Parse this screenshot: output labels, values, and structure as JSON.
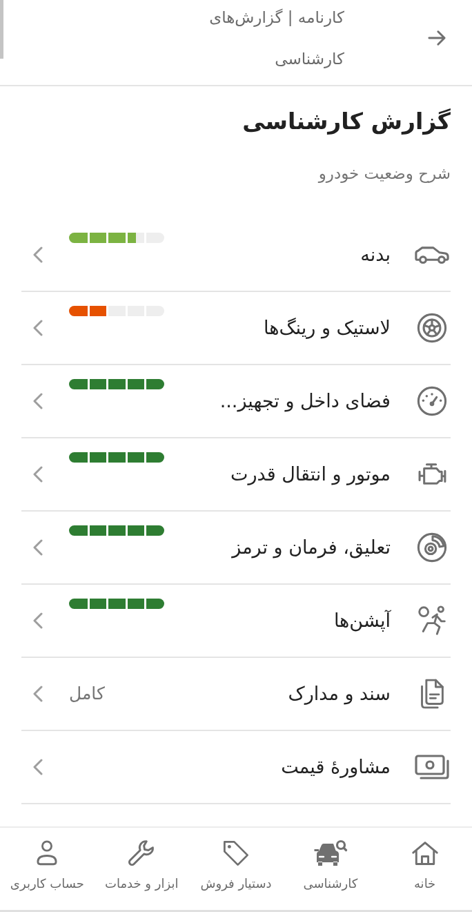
{
  "header": {
    "title": "کارنامه | گزارش‌های کارشناسی"
  },
  "page": {
    "title": "گزارش کارشناسی",
    "subtitle": "شرح وضعیت خودرو"
  },
  "rows": [
    {
      "kind": "meter",
      "label": "بدنه",
      "level": 0.7,
      "color": "#7cb342"
    },
    {
      "kind": "meter",
      "label": "لاستیک و رینگ‌ها",
      "level": 0.4,
      "color": "#e65100"
    },
    {
      "kind": "meter",
      "label": "فضای داخل و تجهیز...",
      "level": 1,
      "color": "#2e7d32"
    },
    {
      "kind": "meter",
      "label": "موتور و انتقال قدرت",
      "level": 1,
      "color": "#2e7d32"
    },
    {
      "kind": "meter",
      "label": "تعلیق، فرمان و ترمز",
      "level": 1,
      "color": "#2e7d32"
    },
    {
      "kind": "meter",
      "label": "آپشن‌ها",
      "level": 1,
      "color": "#2e7d32"
    },
    {
      "kind": "value",
      "label": "سند و مدارک",
      "value": "کامل"
    },
    {
      "kind": "link",
      "label": "مشاورهٔ قیمت"
    }
  ],
  "nav": [
    {
      "label": "خانه"
    },
    {
      "label": "کارشناسی"
    },
    {
      "label": "دستیار فروش"
    },
    {
      "label": "ابزار و خدمات"
    },
    {
      "label": "حساب کاربری"
    }
  ]
}
